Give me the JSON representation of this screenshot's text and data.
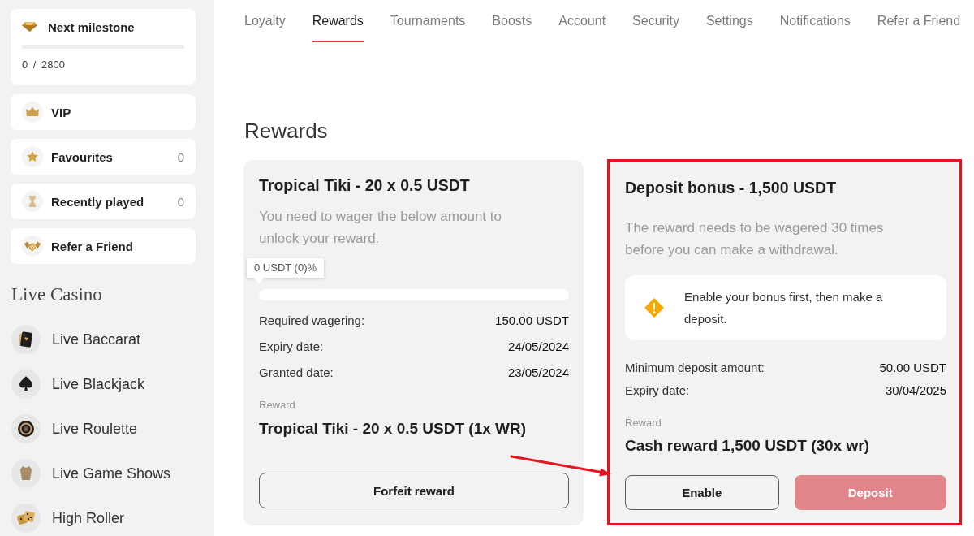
{
  "sidebar": {
    "milestone": {
      "title": "Next milestone",
      "level": 0,
      "progress": "0 / 2800"
    },
    "items": [
      {
        "label": "VIP"
      },
      {
        "label": "Favourites",
        "count": "0"
      },
      {
        "label": "Recently played",
        "count": "0"
      },
      {
        "label": "Refer a Friend"
      }
    ],
    "live_casino": {
      "title": "Live Casino",
      "items": [
        {
          "label": "Live Baccarat"
        },
        {
          "label": "Live Blackjack"
        },
        {
          "label": "Live Roulette"
        },
        {
          "label": "Live Game Shows"
        },
        {
          "label": "High Roller"
        }
      ]
    }
  },
  "tabs": [
    {
      "label": "Loyalty",
      "selected": false
    },
    {
      "label": "Rewards",
      "selected": true
    },
    {
      "label": "Tournaments",
      "selected": false
    },
    {
      "label": "Boosts",
      "selected": false
    },
    {
      "label": "Account",
      "selected": false
    },
    {
      "label": "Security",
      "selected": false
    },
    {
      "label": "Settings",
      "selected": false
    },
    {
      "label": "Notifications",
      "selected": false
    },
    {
      "label": "Refer a Friend",
      "selected": false
    }
  ],
  "page_title": "Rewards",
  "rewards": [
    {
      "title": "Tropical Tiki - 20 x 0.5 USDT",
      "description": "You need to wager the below amount to unlock your reward.",
      "progress": {
        "tooltip": "0 USDT (0)%",
        "level": 0
      },
      "details": [
        {
          "label": "Required wagering:",
          "value": "150.00 USDT"
        },
        {
          "label": "Expiry date:",
          "value": "24/05/2024"
        },
        {
          "label": "Granted date:",
          "value": "23/05/2024"
        }
      ],
      "reward_label": "Reward",
      "reward": "Tropical Tiki - 20 x 0.5 USDT (1x WR)",
      "buttons": [
        {
          "label": "Forfeit reward",
          "kind": "outline",
          "disabled": false
        }
      ],
      "highlighted": false
    },
    {
      "title": "Deposit bonus - 1,500 USDT",
      "description": "The reward needs to be wagered 30 times before you can make a withdrawal.",
      "notice": {
        "text": "Enable your bonus first, then make a deposit."
      },
      "details": [
        {
          "label": "Minimum deposit amount:",
          "value": "50.00 USDT"
        },
        {
          "label": "Expiry date:",
          "value": "30/04/2025"
        }
      ],
      "reward_label": "Reward",
      "reward": "Cash reward 1,500 USDT (30x wr)",
      "buttons": [
        {
          "label": "Enable",
          "kind": "outline",
          "disabled": false
        },
        {
          "label": "Deposit",
          "kind": "primary",
          "disabled": true
        }
      ],
      "highlighted": true
    }
  ],
  "pointer_arrow": true
}
